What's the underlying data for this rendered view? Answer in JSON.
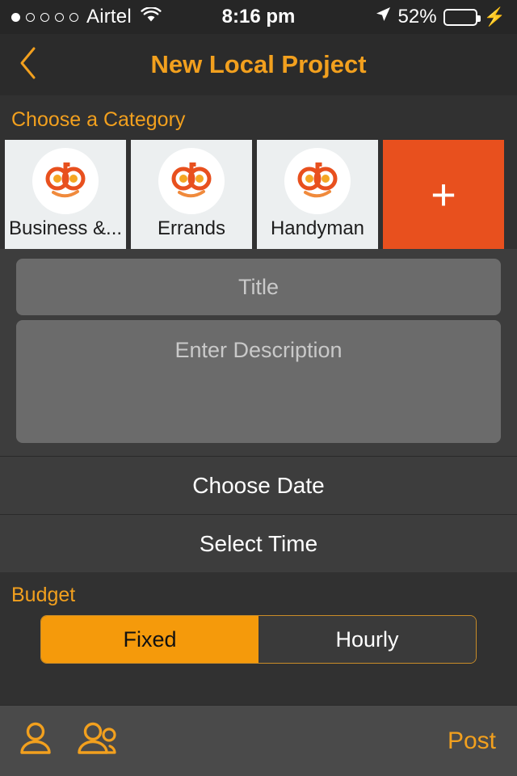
{
  "statusbar": {
    "signal_dots_total": 5,
    "signal_dots_filled": 1,
    "carrier": "Airtel",
    "wifi_icon": "wifi-icon",
    "time": "8:16 pm",
    "location_icon": "location-arrow-icon",
    "battery_percent": "52%",
    "battery_level": 52,
    "battery_fill_color": "#4cd964",
    "charging_icon": "lightning-bolt-icon"
  },
  "navbar": {
    "back_icon": "chevron-left-icon",
    "title": "New Local Project",
    "accent_color": "#f2a01e"
  },
  "category": {
    "section_label": "Choose a Category",
    "items": [
      {
        "label": "Business &...",
        "icon": "do-logo-icon"
      },
      {
        "label": "Errands",
        "icon": "do-logo-icon"
      },
      {
        "label": "Handyman",
        "icon": "do-logo-icon"
      }
    ],
    "add_button": {
      "label": "+",
      "icon": "plus-icon",
      "color": "#e8501e"
    }
  },
  "form": {
    "title_value": "",
    "title_placeholder": "Title",
    "description_value": "",
    "description_placeholder": "Enter Description"
  },
  "rows": [
    {
      "label": "Choose Date",
      "name": "choose-date-row"
    },
    {
      "label": "Select Time",
      "name": "select-time-row"
    }
  ],
  "budget": {
    "label": "Budget",
    "options": [
      {
        "label": "Fixed",
        "selected": true
      },
      {
        "label": "Hourly",
        "selected": false
      }
    ],
    "selected_color": "#f59a0b"
  },
  "toolbar": {
    "person_icon": "person-icon",
    "people_icon": "people-group-icon",
    "post_label": "Post"
  }
}
